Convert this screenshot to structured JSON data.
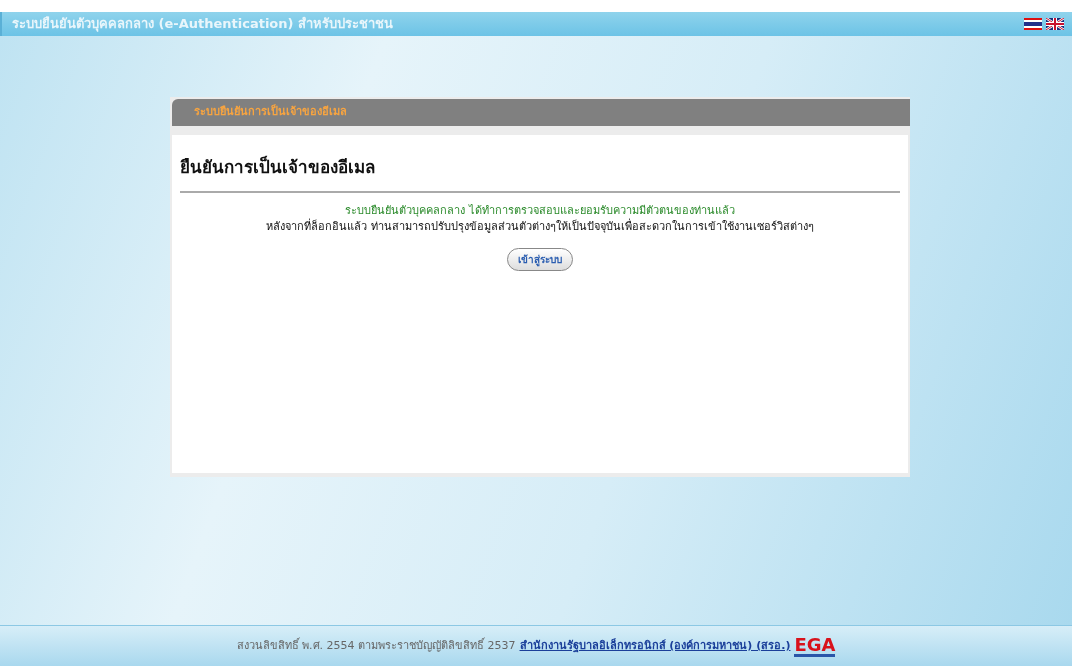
{
  "header": {
    "title": "ระบบยืนยันตัวบุคคลกลาง (e-Authentication) สำหรับประชาชน",
    "languages": [
      {
        "kind": "thai"
      },
      {
        "kind": "british"
      }
    ]
  },
  "panel": {
    "title": "ระบบยืนยันการเป็นเจ้าของอีเมล",
    "heading": "ยืนยันการเป็นเจ้าของอีเมล",
    "message": "ระบบยืนยันตัวบุคคลกลาง ได้ทำการตรวจสอบและยอมรับความมีตัวตนของท่านแล้ว",
    "note": "หลังจากที่ล็อกอินแล้ว ท่านสามารถปรับปรุงข้อมูลส่วนตัวต่างๆให้เป็นปัจจุบันเพื่อสะดวกในการเข้าใช้งานเซอร์วิสต่างๆ",
    "button": "เข้าสู่ระบบ"
  },
  "footer": {
    "text": "สงวนลิขสิทธิ์ พ.ศ. 2554 ตามพระราชบัญญัติลิขสิทธิ์ 2537",
    "link": "สำนักงานรัฐบาลอิเล็กทรอนิกส์ (องค์การมหาชน) (สรอ.)",
    "logo": "EGA"
  }
}
